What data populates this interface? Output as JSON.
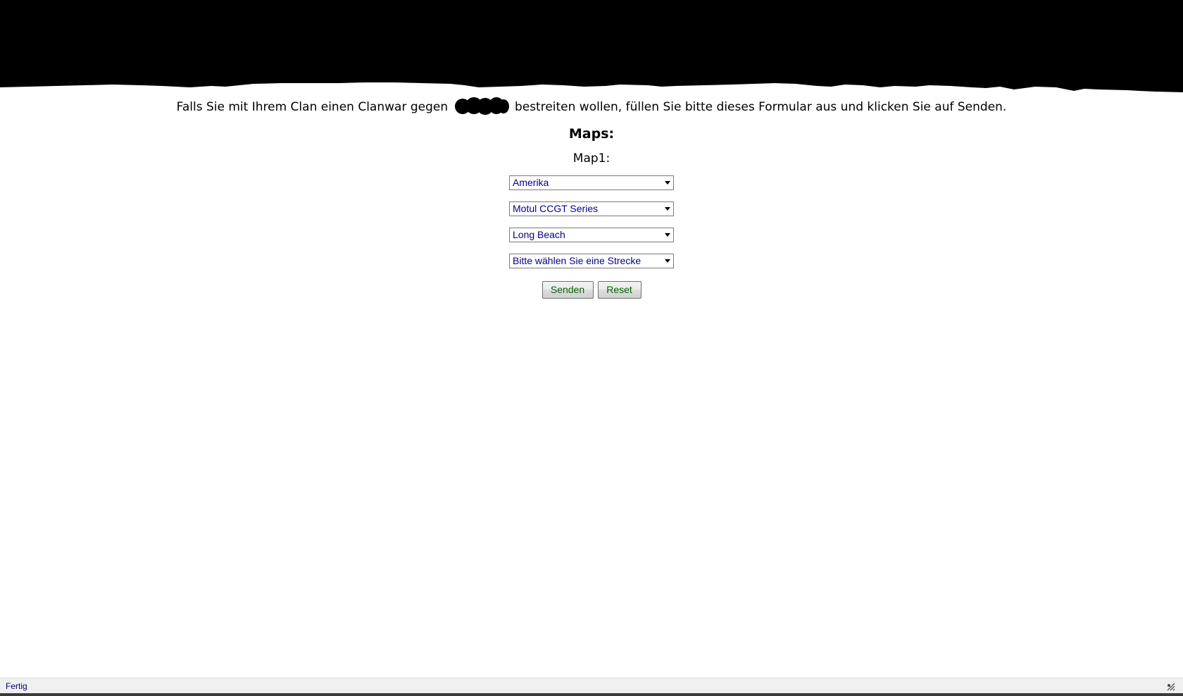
{
  "intro": {
    "text_before": "Falls Sie mit Ihrem Clan einen Clanwar gegen",
    "text_after": "bestreiten wollen, füllen Sie bitte dieses Formular aus und klicken Sie auf Senden."
  },
  "section": {
    "title": "Maps:",
    "map_label": "Map1:"
  },
  "selects": [
    {
      "value": "Amerika"
    },
    {
      "value": "Motul CCGT Series"
    },
    {
      "value": "Long Beach"
    },
    {
      "value": "Bitte wählen Sie eine Strecke"
    }
  ],
  "buttons": {
    "send_label": "Senden",
    "reset_label": "Reset"
  },
  "statusbar": {
    "text": "Fertig"
  },
  "colors": {
    "select_text": "#00008b",
    "button_text": "#006400",
    "status_text": "#000080",
    "redaction": "#000000"
  }
}
